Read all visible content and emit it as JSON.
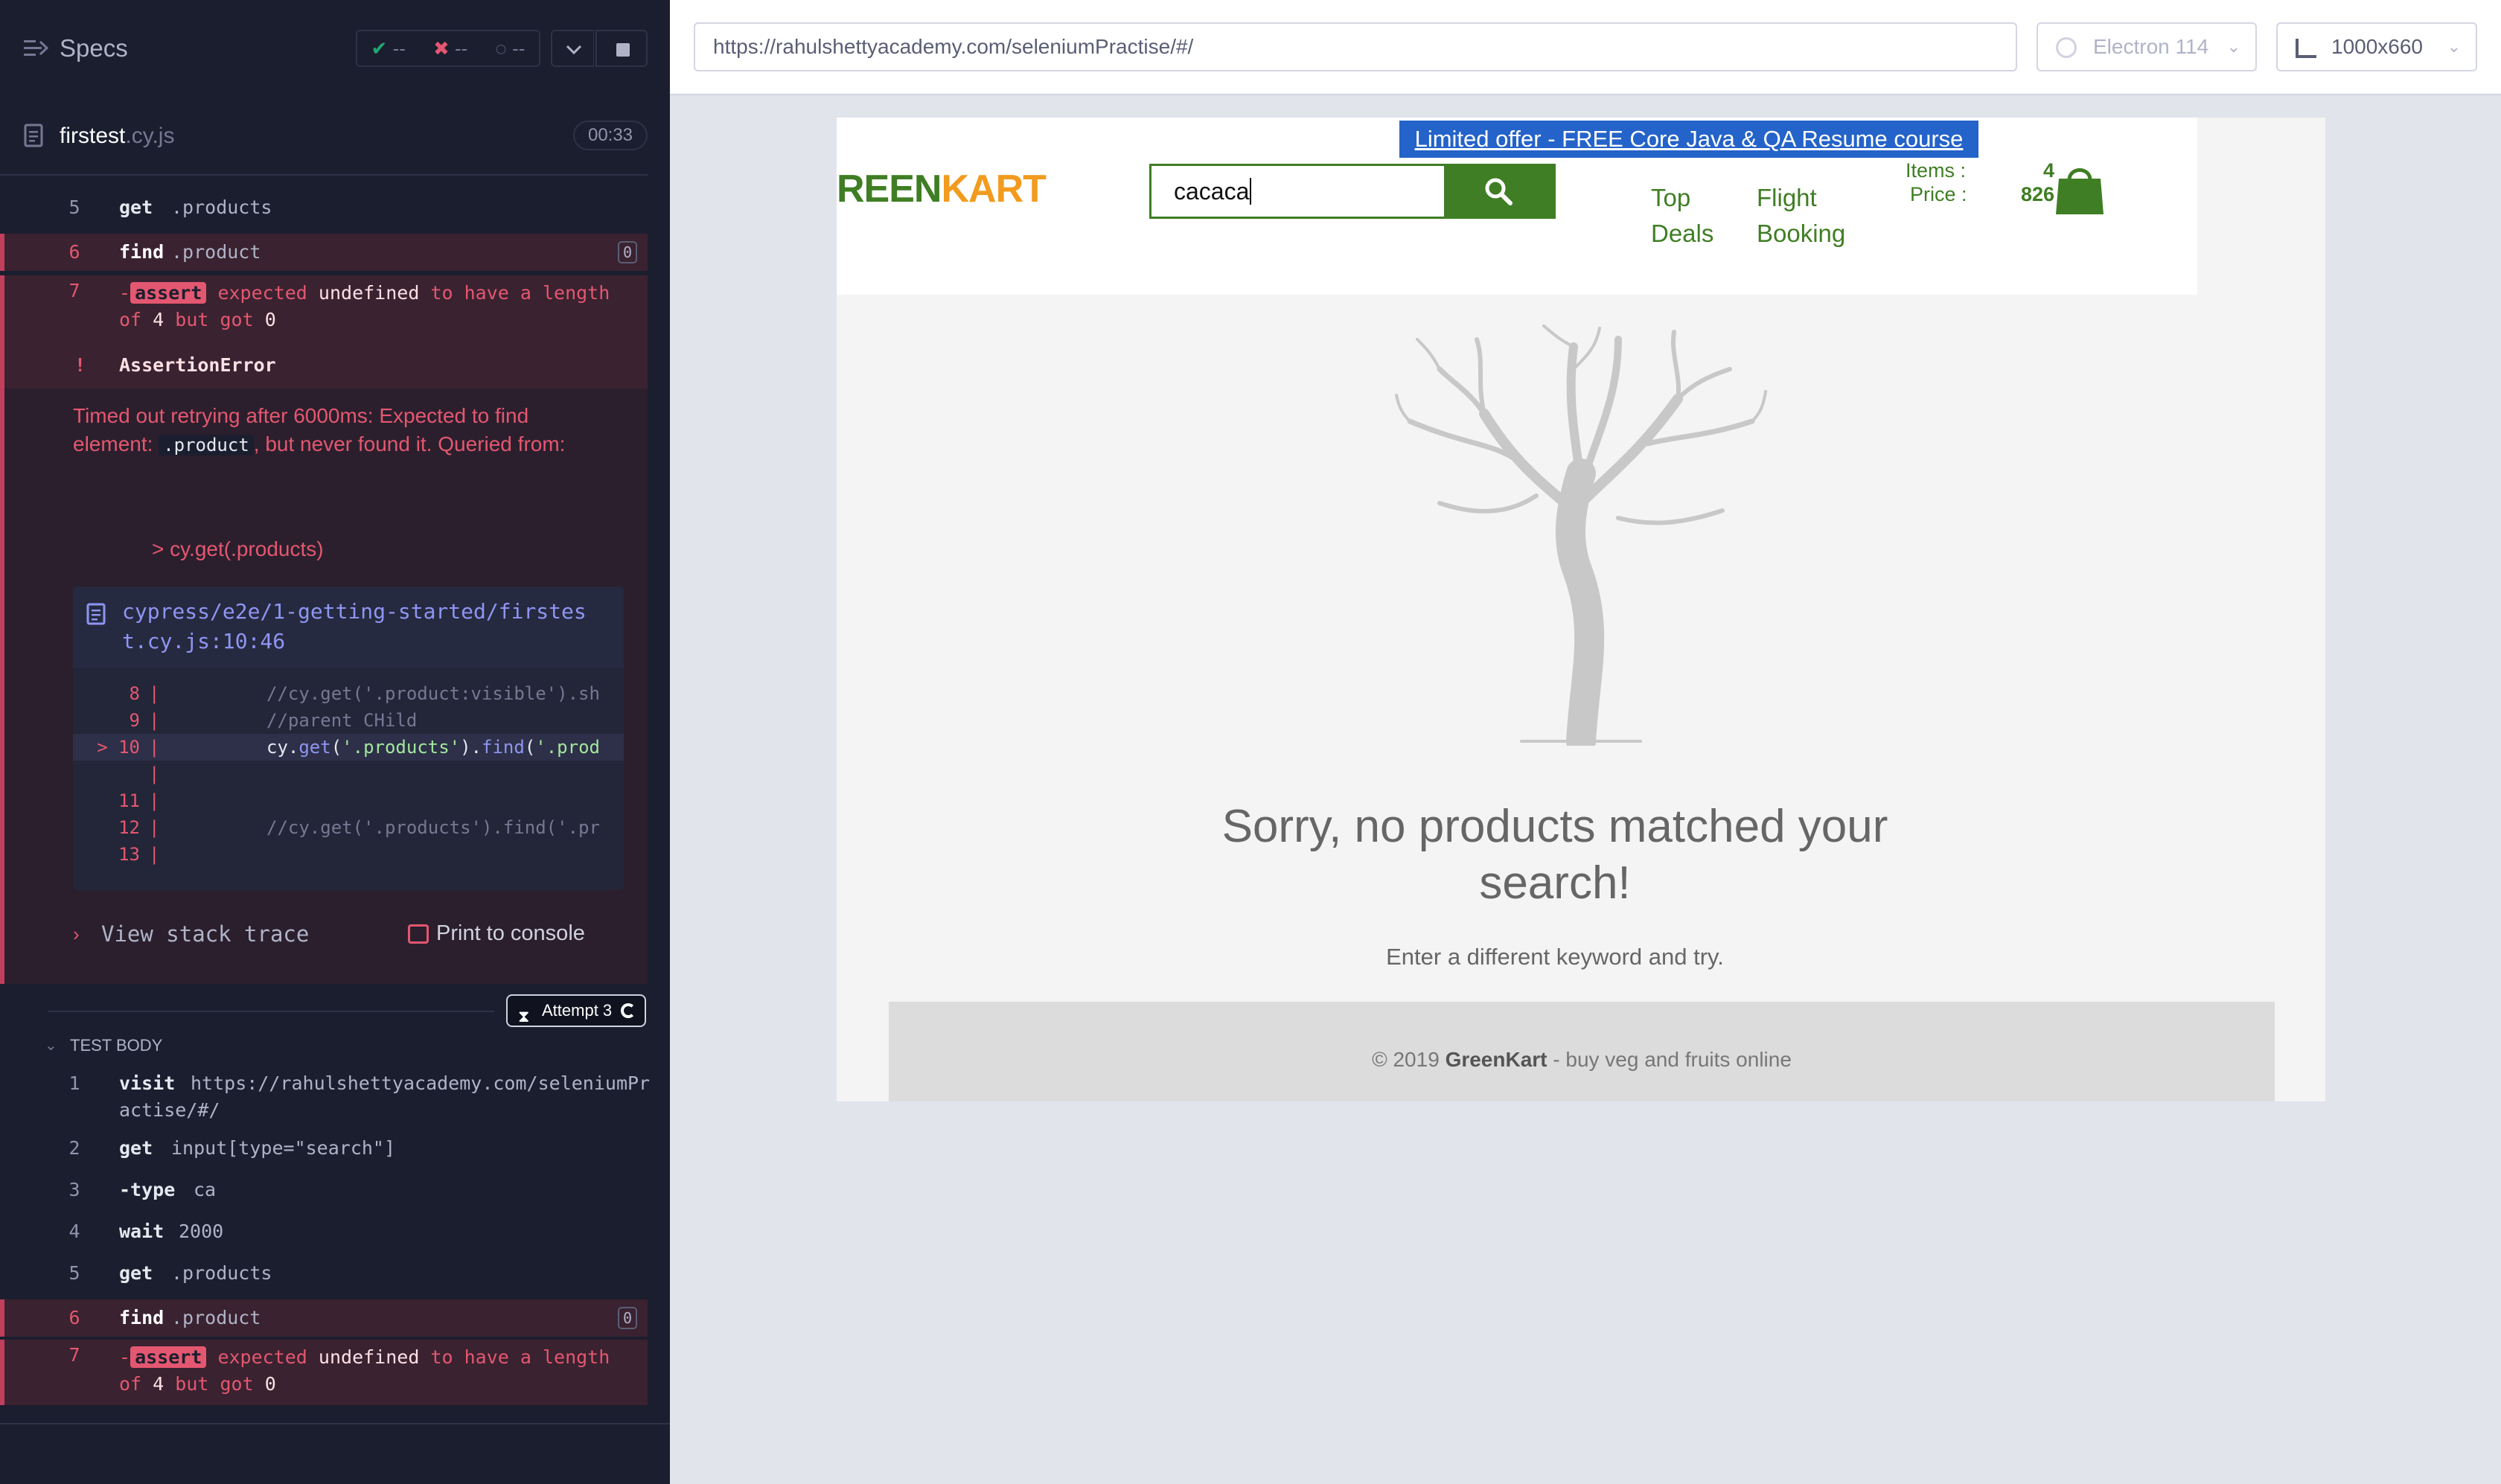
{
  "runner": {
    "specs_label": "Specs",
    "stats": {
      "passed": "--",
      "failed": "--",
      "pending": "--"
    },
    "file": {
      "name": "firstest",
      "ext": ".cy.js",
      "duration": "00:33"
    }
  },
  "commands_top": [
    {
      "num": "5",
      "name": "get",
      "msg": ".products"
    },
    {
      "num": "6",
      "name": "find",
      "msg": ".product",
      "badge": "0"
    }
  ],
  "assert_top": {
    "num": "7",
    "prefix": "-",
    "tag": "assert",
    "w1": "expected",
    "w2": "undefined",
    "w3": "to have a length",
    "w4": "of",
    "w5": "4",
    "w6": "but got",
    "w7": "0"
  },
  "error": {
    "bang": "!",
    "name": "AssertionError",
    "msg_1": "Timed out retrying after 6000ms: Expected to find",
    "msg_2": "element:",
    "msg_code": ".product",
    "msg_3": ", but never found it. Queried from:",
    "query": "> cy.get(.products)",
    "frame_file": "cypress/e2e/1-getting-started/firstest.cy.js:10:46",
    "code_lines": [
      {
        "ln": "8",
        "bar": "|",
        "txt": "//cy.get('.product:visible').sh"
      },
      {
        "ln": "9",
        "bar": "|",
        "txt": "//parent CHild"
      },
      {
        "ln": "> 10",
        "bar": "|",
        "txt_a": "cy.",
        "txt_fn1": "get",
        "txt_b": "(",
        "txt_s1": "'.products'",
        "txt_c": ").",
        "txt_fn2": "find",
        "txt_d": "(",
        "txt_s2": "'.prod"
      },
      {
        "ln": "",
        "bar": "|",
        "txt": ""
      },
      {
        "ln": "11",
        "bar": "|",
        "txt": ""
      },
      {
        "ln": "12",
        "bar": "|",
        "txt": "//cy.get('.products').find('.pr"
      },
      {
        "ln": "13",
        "bar": "|",
        "txt": ""
      }
    ],
    "view_stack": "View stack trace",
    "print_console": "Print to console"
  },
  "attempt": "Attempt 3",
  "test_body_label": "TEST BODY",
  "test_body": [
    {
      "num": "1",
      "name": "visit",
      "msg1": "https://rahulshettyacademy.com/seleniumPr",
      "msg2": "actise/#/"
    },
    {
      "num": "2",
      "name": "get",
      "msg": "input[type=\"search\"]"
    },
    {
      "num": "3",
      "name": "-type",
      "msg": "ca"
    },
    {
      "num": "4",
      "name": "wait",
      "msg": "2000"
    },
    {
      "num": "5",
      "name": "get",
      "msg": ".products"
    },
    {
      "num": "6",
      "name": "find",
      "msg": ".product",
      "badge": "0"
    }
  ],
  "assert_bottom": {
    "num": "7",
    "prefix": "-",
    "tag": "assert",
    "w1": "expected",
    "w2": "undefined",
    "w3": "to have a length",
    "w4": "of",
    "w5": "4",
    "w6": "but got",
    "w7": "0"
  },
  "browser": {
    "url": "https://rahulshettyacademy.com/seleniumPractise/#/",
    "browser_name": "Electron 114",
    "viewport": "1000x660"
  },
  "aut": {
    "promo": "Limited offer - FREE Core Java & QA Resume course",
    "brand_green": "REEN",
    "brand_orange": "KART",
    "search_value": "cacaca",
    "nav_top_1": "Top",
    "nav_top_2": "Deals",
    "nav_flight_1": "Flight",
    "nav_flight_2": "Booking",
    "items_label": "Items  :",
    "items_value": "4",
    "price_label": "Price  :",
    "price_value": "826",
    "empty_title_1": "Sorry, no products matched your",
    "empty_title_2": "search!",
    "empty_sub": "Enter a different keyword and try.",
    "footer_pre": "© 2019 ",
    "footer_brand": "GreenKart",
    "footer_post": " - buy veg and fruits online"
  },
  "colors": {
    "runner_bg": "#1b1e2e",
    "error_red": "#e45770",
    "brand_green": "#3f7e24",
    "brand_orange": "#f29b1e",
    "promo_blue": "#2463c9"
  }
}
